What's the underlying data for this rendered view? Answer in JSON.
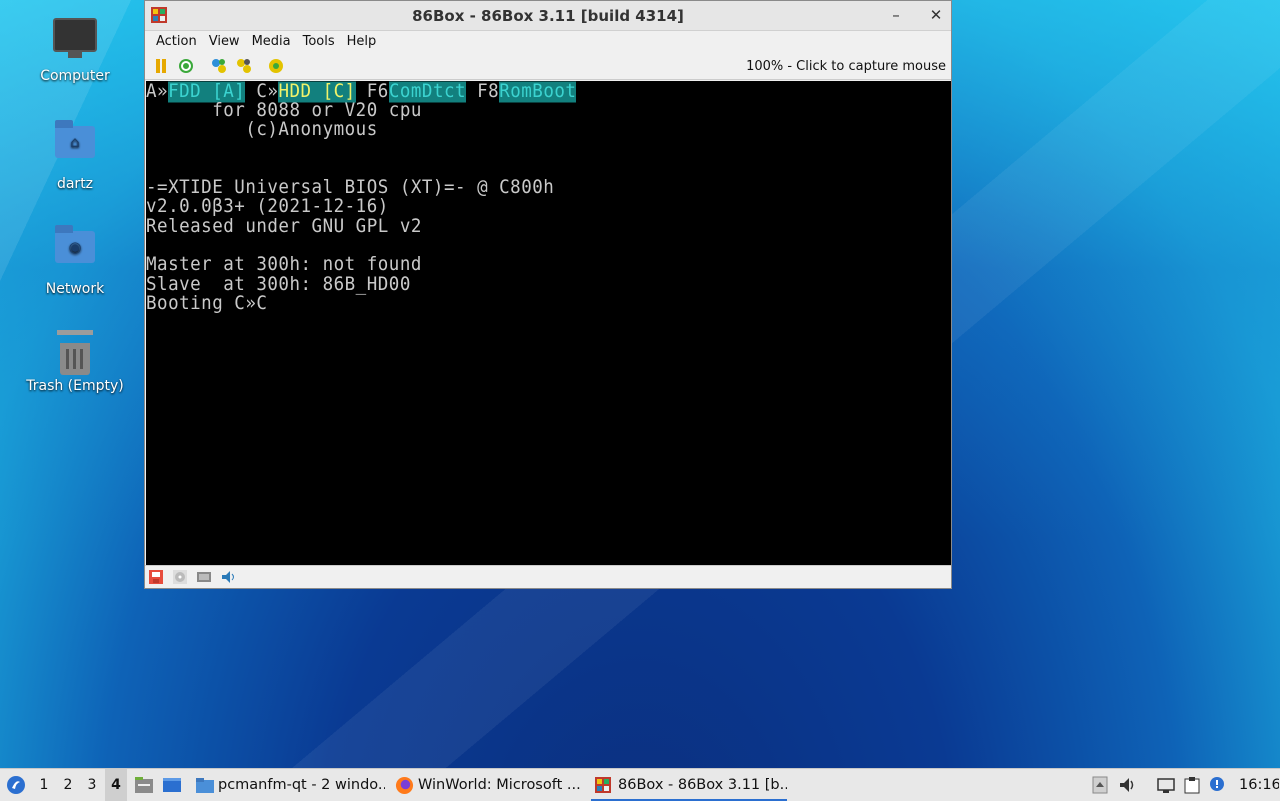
{
  "desktop": {
    "icons": [
      {
        "label": "Computer"
      },
      {
        "label": "dartz"
      },
      {
        "label": "Network"
      },
      {
        "label": "Trash (Empty)"
      }
    ]
  },
  "window": {
    "title": "86Box - 86Box 3.11 [build 4314]",
    "minimize": "–",
    "close": "✕",
    "menu": [
      "Action",
      "View",
      "Media",
      "Tools",
      "Help"
    ],
    "status_text": "100% - Click to capture mouse",
    "screen": {
      "boot_menu": {
        "a_prefix": "A»",
        "a_label": "FDD [A]",
        "c_prefix": " C»",
        "c_label": "HDD [C]",
        "f6_prefix": " F6",
        "f6_label": "ComDtct",
        "f8_prefix": " F8",
        "f8_label": "RomBoot"
      },
      "lines": [
        "      for 8088 or V20 cpu",
        "         (c)Anonymous",
        "",
        "",
        "-=XTIDE Universal BIOS (XT)=- @ C800h",
        "v2.0.0β3+ (2021-12-16)",
        "Released under GNU GPL v2",
        "",
        "Master at 300h: not found",
        "Slave  at 300h: 86B_HD00",
        "Booting C»C"
      ]
    }
  },
  "taskbar": {
    "workspaces": [
      "1",
      "2",
      "3",
      "4"
    ],
    "active_workspace": "4",
    "tasks": [
      {
        "label": "pcmanfm-qt - 2 windo..."
      },
      {
        "label": "WinWorld: Microsoft ..."
      },
      {
        "label": "86Box - 86Box 3.11 [b..."
      }
    ],
    "clock": "16:16"
  },
  "colors": {
    "screen_highlight_bg": "#12807e",
    "screen_highlight_fg": "#3bd3d0",
    "screen_highlight_yellow": "#f1f36a",
    "taskbar_accent": "#2b6fd0"
  }
}
